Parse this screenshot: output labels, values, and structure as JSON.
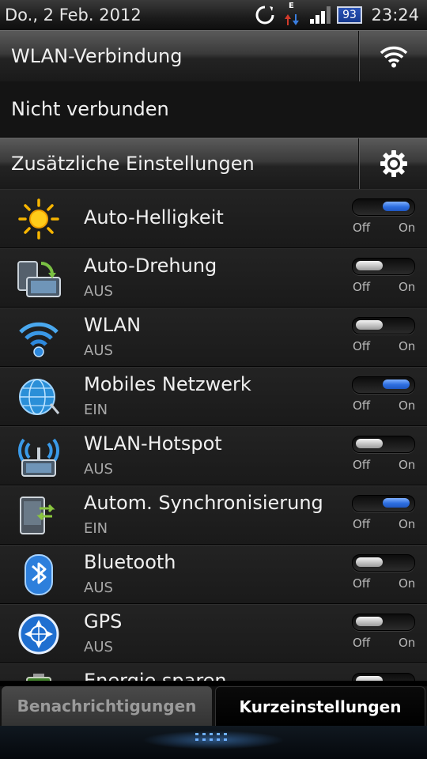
{
  "status_bar": {
    "date": "Do., 2 Feb. 2012",
    "time": "23:24",
    "battery_level": "93",
    "network_type": "E",
    "icons": [
      "sync-icon",
      "mobile-data-icon",
      "signal-strength-icon",
      "battery-icon"
    ]
  },
  "wlan_header": {
    "label": "WLAN-Verbindung",
    "icon": "wifi-icon"
  },
  "wlan_status": {
    "text": "Nicht verbunden"
  },
  "extra_settings": {
    "label": "Zusätzliche Einstellungen",
    "icon": "gear-icon"
  },
  "toggle_labels": {
    "off": "Off",
    "on": "On"
  },
  "settings": [
    {
      "title": "Auto-Helligkeit",
      "subtitle": "",
      "state": "on",
      "icon": "sun-icon"
    },
    {
      "title": "Auto-Drehung",
      "subtitle": "AUS",
      "state": "off",
      "icon": "rotation-icon"
    },
    {
      "title": "WLAN",
      "subtitle": "AUS",
      "state": "off",
      "icon": "wifi-icon"
    },
    {
      "title": "Mobiles Netzwerk",
      "subtitle": "EIN",
      "state": "on",
      "icon": "globe-icon"
    },
    {
      "title": "WLAN-Hotspot",
      "subtitle": "AUS",
      "state": "off",
      "icon": "hotspot-icon"
    },
    {
      "title": "Autom. Synchronisierung",
      "subtitle": "EIN",
      "state": "on",
      "icon": "sync-device-icon"
    },
    {
      "title": "Bluetooth",
      "subtitle": "AUS",
      "state": "off",
      "icon": "bluetooth-icon"
    },
    {
      "title": "GPS",
      "subtitle": "AUS",
      "state": "off",
      "icon": "gps-icon"
    },
    {
      "title": "Energie sparen",
      "subtitle": "",
      "state": "off",
      "icon": "battery-saver-icon"
    }
  ],
  "tabs": [
    {
      "label": "Benachrichtigungen",
      "active": false
    },
    {
      "label": "Kurzeinstellungen",
      "active": true
    }
  ]
}
